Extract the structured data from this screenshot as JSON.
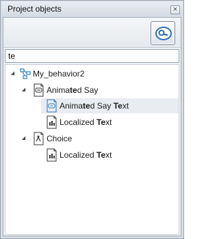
{
  "panel": {
    "title": "Project objects",
    "close_glyph": "×"
  },
  "search": {
    "value": "te",
    "placeholder": "",
    "button_icon": "search-icon"
  },
  "tree": {
    "root": {
      "label": "My_behavior2",
      "icon": "hierarchy-icon",
      "children": [
        {
          "label_parts": [
            "Anima",
            "te",
            "d Say"
          ],
          "icon": "say-icon",
          "expanded": true,
          "children": [
            {
              "label_parts": [
                "Anima",
                "te",
                "d Say ",
                "Te",
                "xt"
              ],
              "icon": "say-text-icon",
              "selected": true
            },
            {
              "label_parts": [
                "Localized ",
                "Te",
                "xt"
              ],
              "icon": "localized-text-icon"
            }
          ]
        },
        {
          "label": "Choice",
          "icon": "choice-icon",
          "expanded": true,
          "children": [
            {
              "label_parts": [
                "Localized ",
                "Te",
                "xt"
              ],
              "icon": "localized-text-icon"
            }
          ]
        }
      ]
    }
  }
}
